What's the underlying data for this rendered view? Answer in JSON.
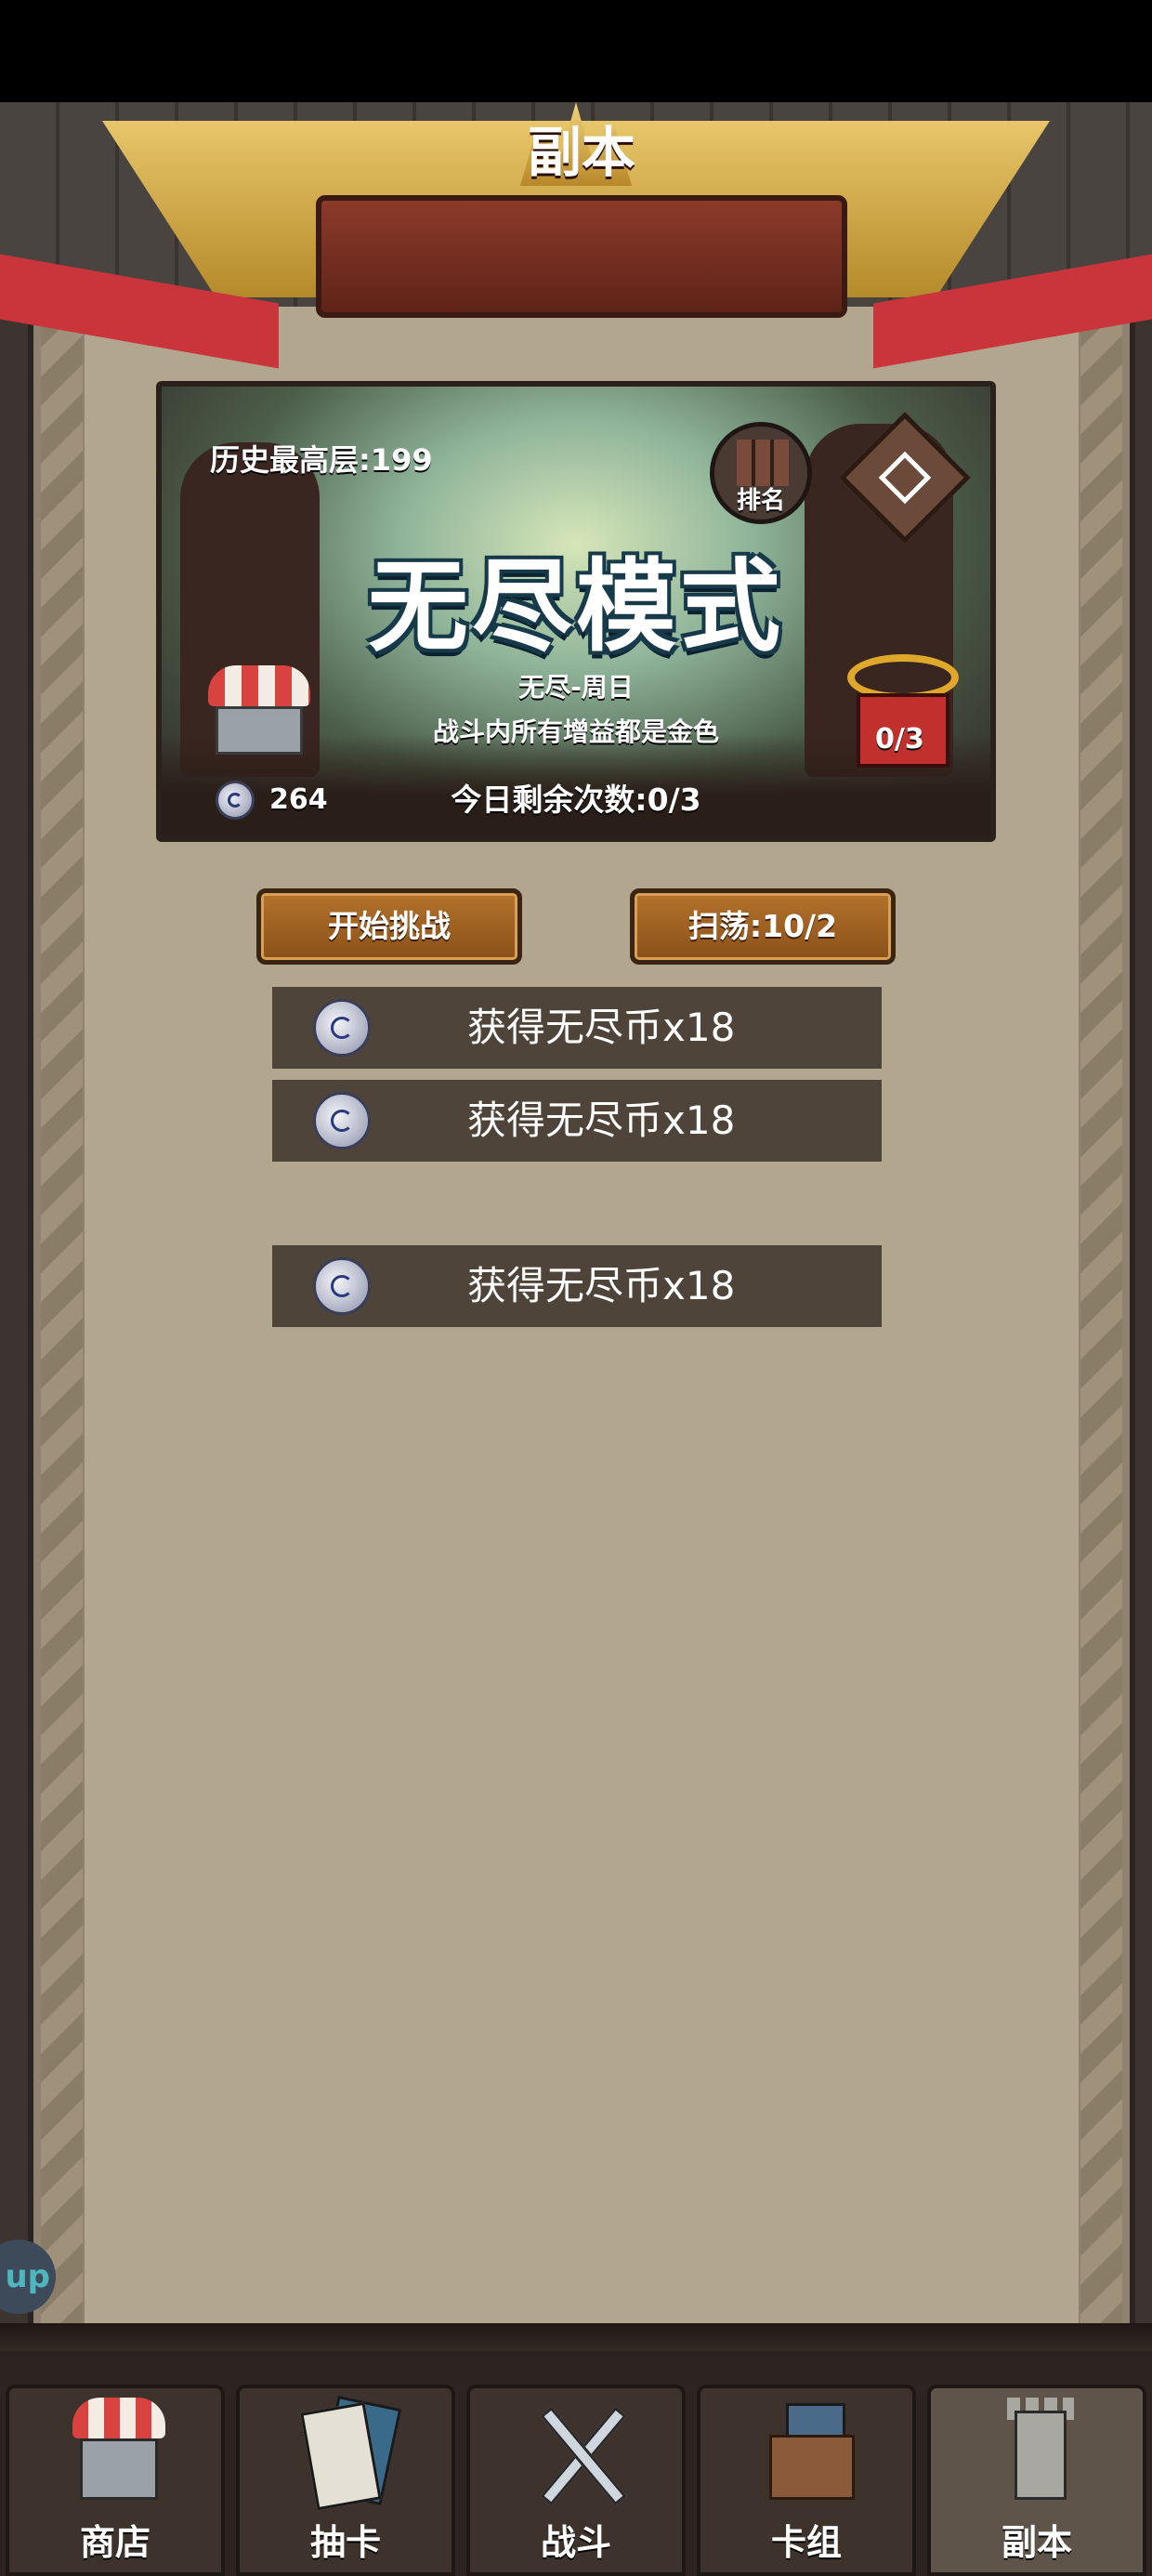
{
  "header": {
    "title": "副本"
  },
  "endless": {
    "best_floor": "历史最高层:199",
    "rank_label": "排名",
    "mode_title": "无尽模式",
    "mode_subtitle": "无尽-周日",
    "mode_description": "战斗内所有增益都是金色",
    "gift_progress": "0/3",
    "coin_count": "264",
    "remaining_attempts": "今日剩余次数:0/3"
  },
  "actions": {
    "start_label": "开始挑战",
    "sweep_label": "扫荡:10/2"
  },
  "rewards": [
    {
      "text": "获得无尽币x18",
      "icon": "endless-coin-icon"
    },
    {
      "text": "获得无尽币x18",
      "icon": "endless-coin-icon"
    },
    {
      "text": "获得无尽币x18",
      "icon": "endless-coin-icon"
    }
  ],
  "side_button": {
    "text": "up"
  },
  "nav": {
    "tabs": [
      {
        "label": "商店",
        "icon": "shop-icon"
      },
      {
        "label": "抽卡",
        "icon": "card-draw-icon"
      },
      {
        "label": "战斗",
        "icon": "crossed-swords-icon"
      },
      {
        "label": "卡组",
        "icon": "card-deck-icon"
      },
      {
        "label": "副本",
        "icon": "dungeon-tower-icon"
      }
    ],
    "active": "副本"
  },
  "colors": {
    "panel": "#b3a68e",
    "button": "#9a5f22",
    "reward_row": "#4e4439",
    "ribbon": "#c9353b"
  }
}
